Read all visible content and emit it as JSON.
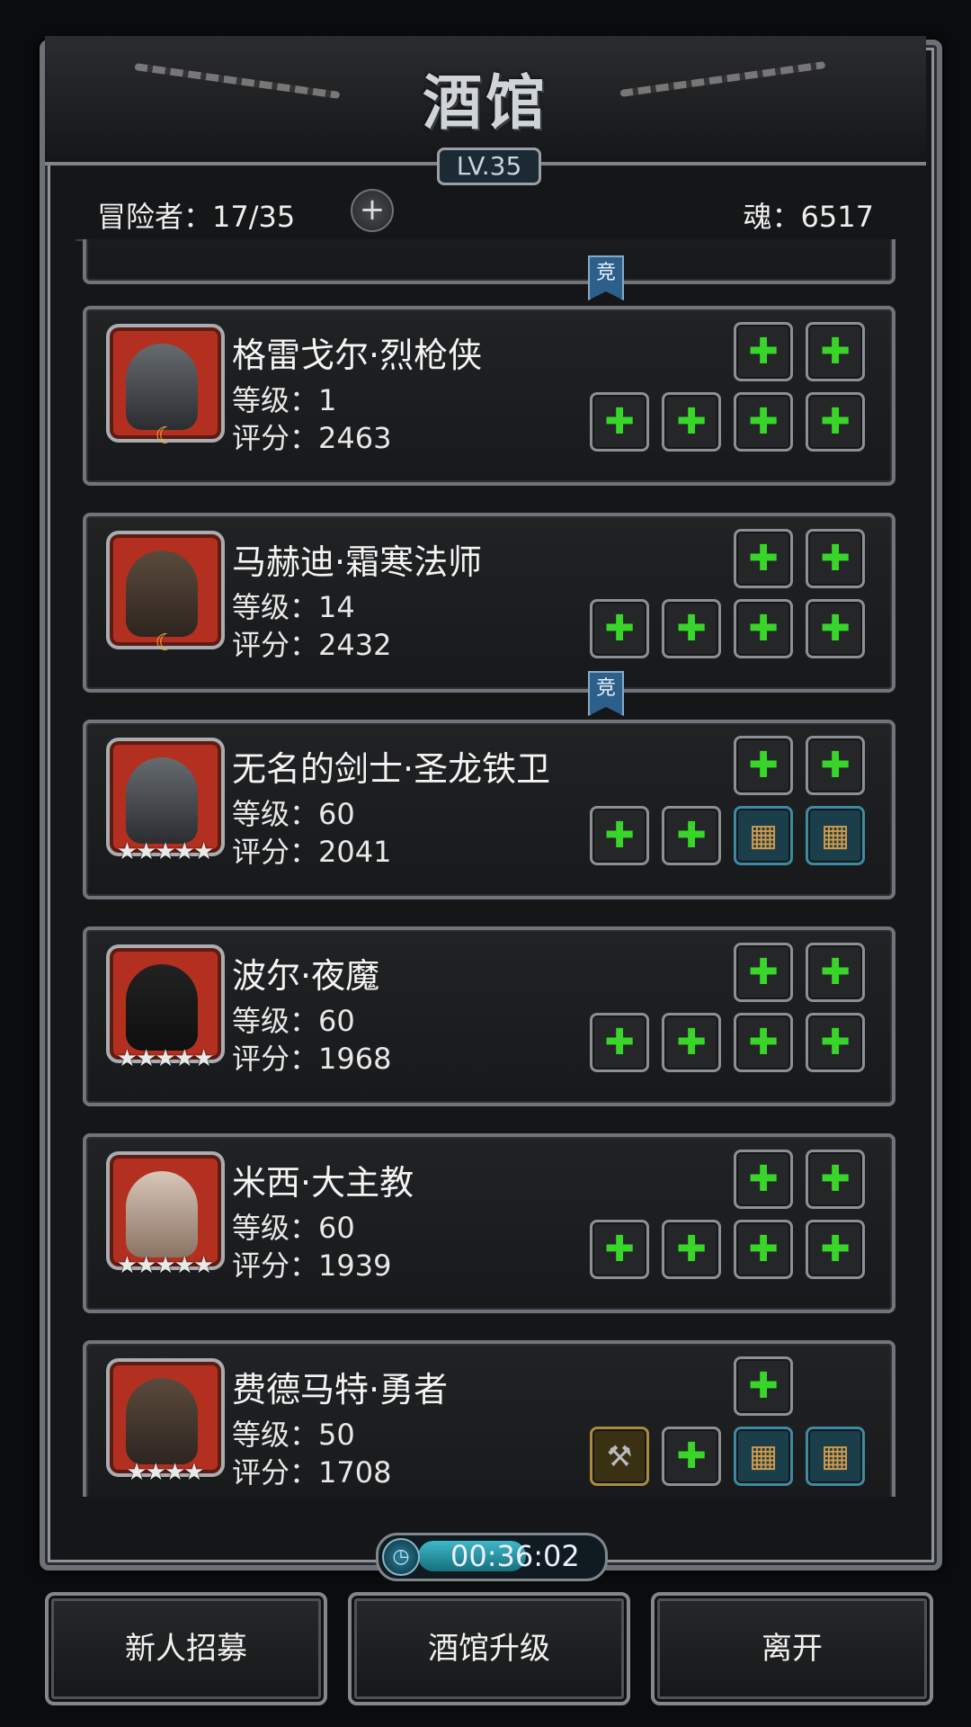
{
  "header": {
    "title": "酒馆",
    "level": "LV.35"
  },
  "topbar": {
    "adventurers": "冒险者：17/35",
    "plus": "+",
    "soul": "魂：6517"
  },
  "tag_text": "竞",
  "heroes": [
    {
      "name": "格雷戈尔·烈枪侠",
      "level": "等级：1",
      "score": "评分：2463",
      "rank": "crescent",
      "stars": ""
    },
    {
      "name": "马赫迪·霜寒法师",
      "level": "等级：14",
      "score": "评分：2432",
      "rank": "crescent",
      "stars": ""
    },
    {
      "name": "无名的剑士·圣龙铁卫",
      "level": "等级：60",
      "score": "评分：2041",
      "rank": "stars",
      "stars": "★★★★★"
    },
    {
      "name": "波尔·夜魔",
      "level": "等级：60",
      "score": "评分：1968",
      "rank": "stars",
      "stars": "★★★★★"
    },
    {
      "name": "米西·大主教",
      "level": "等级：60",
      "score": "评分：1939",
      "rank": "stars",
      "stars": "★★★★★"
    },
    {
      "name": "费德马特·勇者",
      "level": "等级：50",
      "score": "评分：1708",
      "rank": "stars",
      "stars": "★★★★"
    }
  ],
  "timer": {
    "value": "00:36:02",
    "progress": 0.6
  },
  "buttons": {
    "recruit": "新人招募",
    "upgrade": "酒馆升级",
    "leave": "离开"
  },
  "icons": {
    "empty_slot": "green-plus-icon",
    "armor": "armor-icon",
    "weapon": "axe-icon"
  },
  "colors": {
    "plus_green": "#39d62a",
    "tag_blue": "#2c5f8a",
    "portrait_red": "#b33020"
  }
}
